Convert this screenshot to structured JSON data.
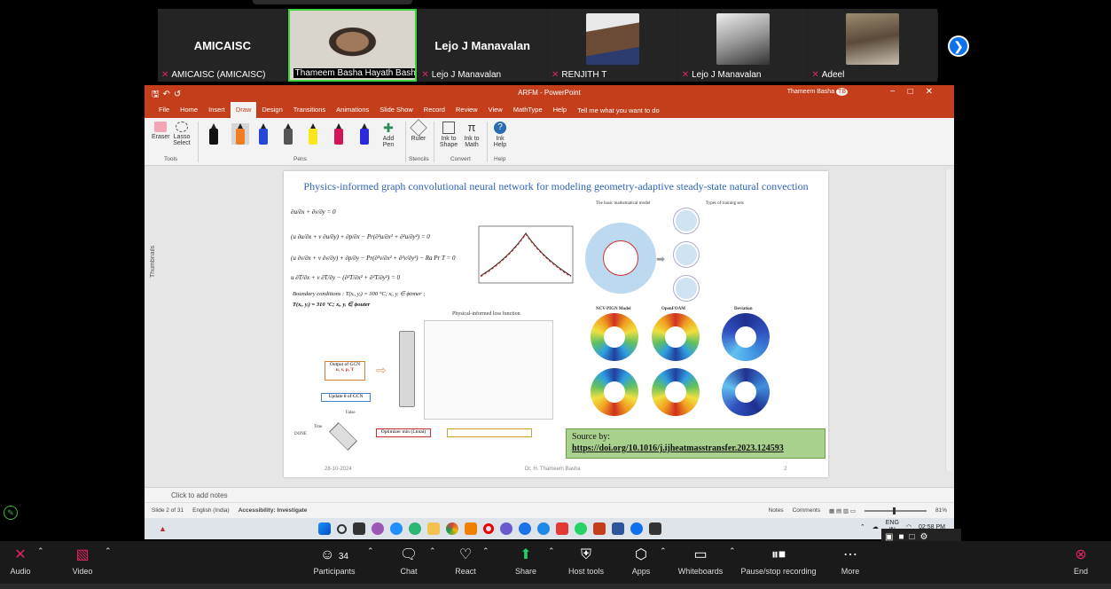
{
  "gallery": {
    "participants": [
      {
        "big_name": "AMICAISC",
        "label": "AMICAISC (AMICAISC)",
        "muted": true,
        "type": "name"
      },
      {
        "big_name": "",
        "label": "Thameem Basha Hayath Basha",
        "muted": false,
        "type": "video",
        "active": true
      },
      {
        "big_name": "Lejo J Manavalan",
        "label": "Lejo J Manavalan",
        "muted": true,
        "type": "name"
      },
      {
        "big_name": "",
        "label": "RENJITH T",
        "muted": true,
        "type": "photo"
      },
      {
        "big_name": "",
        "label": "Lejo J Manavalan",
        "muted": true,
        "type": "photo"
      },
      {
        "big_name": "",
        "label": "Adeel",
        "muted": true,
        "type": "photo"
      }
    ]
  },
  "ppt": {
    "window_title": "ARFM - PowerPoint",
    "user_name": "Thameem Basha",
    "user_initials": "TB",
    "menu": [
      "File",
      "Home",
      "Insert",
      "Draw",
      "Design",
      "Transitions",
      "Animations",
      "Slide Show",
      "Record",
      "Review",
      "View",
      "MathType",
      "Help"
    ],
    "active_menu": "Draw",
    "tell_me": "Tell me what you want to do",
    "ribbon": {
      "eraser": "Eraser",
      "lasso": "Lasso Select",
      "tools_group": "Tools",
      "pens_group": "Pens",
      "add_pen": "Add Pen",
      "ruler": "Ruler",
      "stencils_group": "Stencils",
      "ink_to_shape": "Ink to Shape",
      "ink_to_math": "Ink to Math",
      "convert_group": "Convert",
      "ink_help": "Ink Help",
      "help_group": "Help"
    },
    "thumbnails_label": "Thumbnails",
    "slide": {
      "title": "Physics-informed graph convolutional neural network for modeling geometry-adaptive steady-state natural convection",
      "boundary_text": "Boundary conditions : T(xᵢ, yᵢ) = 300 °C; xᵢ, yᵢ ∈ ϕinner ;",
      "boundary_text2": "T(xᵢ, yᵢ) = 310 °C; xᵢ, yᵢ ∈ ϕouter",
      "loss_title": "Physical-informed loss function",
      "basic_model": "The basic mathematical model",
      "training_sets": "Types of training sets",
      "ncv_model": "NCV-PIGN Model",
      "openfoam": "OpenFOAM",
      "deviation": "Deviation",
      "output_gcn": "Output of GCN",
      "output_vars": "u, v, p, T",
      "update_gcn": "Update θ of GCN",
      "false_label": "False",
      "true_label": "True",
      "done_label": "DONE",
      "optimizer": "Optimizer min (Ltotal)",
      "source_label": "Source by:",
      "source_link": "https://doi.org/10.1016/j.ijheatmasstransfer.2023.124593",
      "date": "28-10-2024",
      "author": "Dr. H. Thameem Basha",
      "page": "2"
    },
    "notes_placeholder": "Click to add notes",
    "status": {
      "slide_info": "Slide 2 of 31",
      "language": "English (India)",
      "accessibility": "Accessibility: Investigate",
      "notes": "Notes",
      "comments": "Comments",
      "zoom": "81%"
    }
  },
  "taskbar": {
    "lang": "ENG",
    "lang2": "IN",
    "time": "02:58 PM"
  },
  "zoom_toolbar": {
    "audio": "Audio",
    "video": "Video",
    "participants": "Participants",
    "participants_count": "34",
    "chat": "Chat",
    "react": "React",
    "share": "Share",
    "host_tools": "Host tools",
    "apps": "Apps",
    "whiteboards": "Whiteboards",
    "pause_recording": "Pause/stop recording",
    "more": "More",
    "end": "End"
  },
  "colors": {
    "ppt_accent": "#c43e1c",
    "zoom_blue": "#0e72ed",
    "active_green": "#3fd13f",
    "muted_red": "#e0245e",
    "slide_title_blue": "#2e63b8",
    "source_green": "#a9d18e"
  }
}
